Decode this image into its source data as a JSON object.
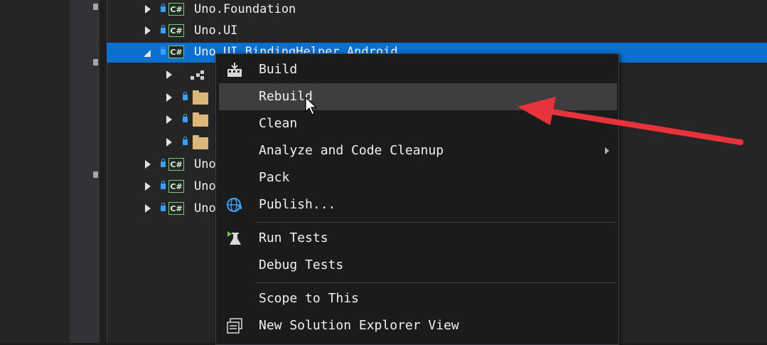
{
  "solution_tree": {
    "rows": [
      {
        "label": "Uno.Foundation",
        "icon": "csharp-project-icon"
      },
      {
        "label": "Uno.UI",
        "icon": "csharp-project-icon"
      },
      {
        "label": "Uno.UI.BindingHelper.Android",
        "icon": "csharp-project-icon",
        "selected": true,
        "expanded": true
      },
      {
        "label": "",
        "icon": "dependencies-icon"
      },
      {
        "label": "",
        "icon": "folder-icon"
      },
      {
        "label": "",
        "icon": "folder-icon"
      },
      {
        "label": "",
        "icon": "folder-icon"
      },
      {
        "label": "Uno",
        "icon": "csharp-project-icon"
      },
      {
        "label": "Uno",
        "icon": "csharp-project-icon"
      },
      {
        "label": "Uno",
        "icon": "csharp-project-icon"
      }
    ],
    "selected_row_visible_text": "Uno.UI.BindingHelper.Android"
  },
  "context_menu": {
    "items": [
      {
        "label": "Build",
        "icon": "build-icon"
      },
      {
        "label": "Rebuild",
        "hovered": true
      },
      {
        "label": "Clean"
      },
      {
        "label": "Analyze and Code Cleanup",
        "has_submenu": true
      },
      {
        "label": "Pack"
      },
      {
        "label": "Publish...",
        "icon": "globe-publish-icon"
      },
      {
        "label": "Run Tests",
        "icon": "run-tests-icon"
      },
      {
        "label": "Debug Tests"
      },
      {
        "label": "Scope to This"
      },
      {
        "label": "New Solution Explorer View",
        "icon": "new-explorer-view-icon"
      }
    ]
  },
  "annotation": {
    "arrow_color": "#e8323c"
  },
  "colors": {
    "selection": "#0a6fcd",
    "menu_hover": "#3e3e40",
    "folder": "#dcb67a",
    "lock": "#3aa0ff",
    "csharp_border": "#7fc77f"
  }
}
